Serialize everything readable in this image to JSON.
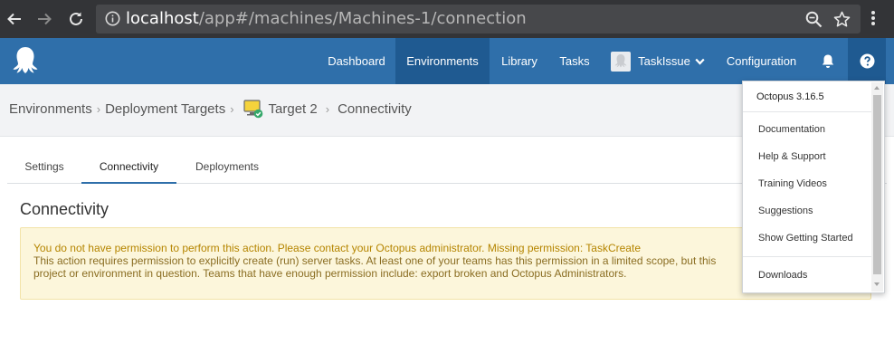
{
  "browser": {
    "url_host": "localhost",
    "url_path": "/app#/machines/Machines-1/connection"
  },
  "nav": {
    "items": [
      "Dashboard",
      "Environments",
      "Library",
      "Tasks"
    ],
    "user": "TaskIssue",
    "configuration": "Configuration"
  },
  "breadcrumb": {
    "environments": "Environments",
    "deployment_targets": "Deployment Targets",
    "target": "Target 2",
    "current": "Connectivity"
  },
  "tabs": [
    "Settings",
    "Connectivity",
    "Deployments"
  ],
  "section_title": "Connectivity",
  "warning": {
    "line1": "You do not have permission to perform this action. Please contact your Octopus administrator. Missing permission: TaskCreate",
    "line2": "This action requires permission to explicitly create (run) server tasks. At least one of your teams has this permission in a limited scope, but this",
    "line3": "project or environment in question. Teams that have enough permission include: export broken and Octopus Administrators."
  },
  "help_menu": {
    "version": "Octopus 3.16.5",
    "items": [
      "Documentation",
      "Help & Support",
      "Training Videos",
      "Suggestions",
      "Show Getting Started"
    ],
    "downloads": "Downloads"
  },
  "colors": {
    "header": "#2f6faa",
    "header_active": "#1f5a91",
    "warning_bg": "#fcf6db",
    "warning_text": "#b58500"
  }
}
